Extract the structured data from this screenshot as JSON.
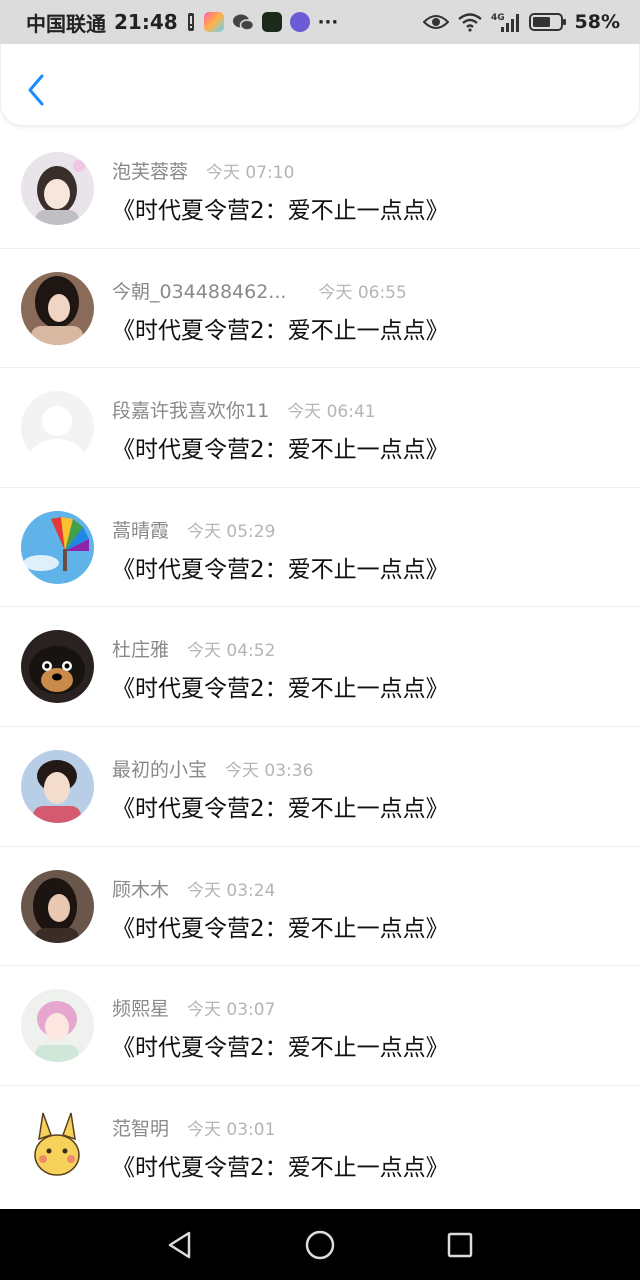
{
  "status_bar": {
    "carrier": "中国联通",
    "time": "21:48",
    "network": "4G",
    "battery": "58%"
  },
  "header": {
    "back_icon": "chevron-left-icon",
    "accent_color": "#1a8cff"
  },
  "comments": [
    {
      "name": "泡芙蓉蓉",
      "time": "今天 07:10",
      "text": "《时代夏令营2：爱不止一点点》"
    },
    {
      "name": "今朝_034488462...",
      "time": "今天 06:55",
      "text": "《时代夏令营2：爱不止一点点》"
    },
    {
      "name": "段嘉许我喜欢你11",
      "time": "今天 06:41",
      "text": "《时代夏令营2：爱不止一点点》"
    },
    {
      "name": "蒿晴霞",
      "time": "今天 05:29",
      "text": "《时代夏令营2：爱不止一点点》"
    },
    {
      "name": "杜庄雅",
      "time": "今天 04:52",
      "text": "《时代夏令营2：爱不止一点点》"
    },
    {
      "name": "最初的小宝",
      "time": "今天 03:36",
      "text": "《时代夏令营2：爱不止一点点》"
    },
    {
      "name": "顾木木",
      "time": "今天 03:24",
      "text": "《时代夏令营2：爱不止一点点》"
    },
    {
      "name": "频熙星",
      "time": "今天 03:07",
      "text": "《时代夏令营2：爱不止一点点》"
    },
    {
      "name": "范智明",
      "time": "今天 03:01",
      "text": "《时代夏令营2：爱不止一点点》"
    }
  ],
  "nav_bar": {
    "back": "triangle-back-icon",
    "home": "circle-home-icon",
    "recents": "square-recents-icon"
  }
}
